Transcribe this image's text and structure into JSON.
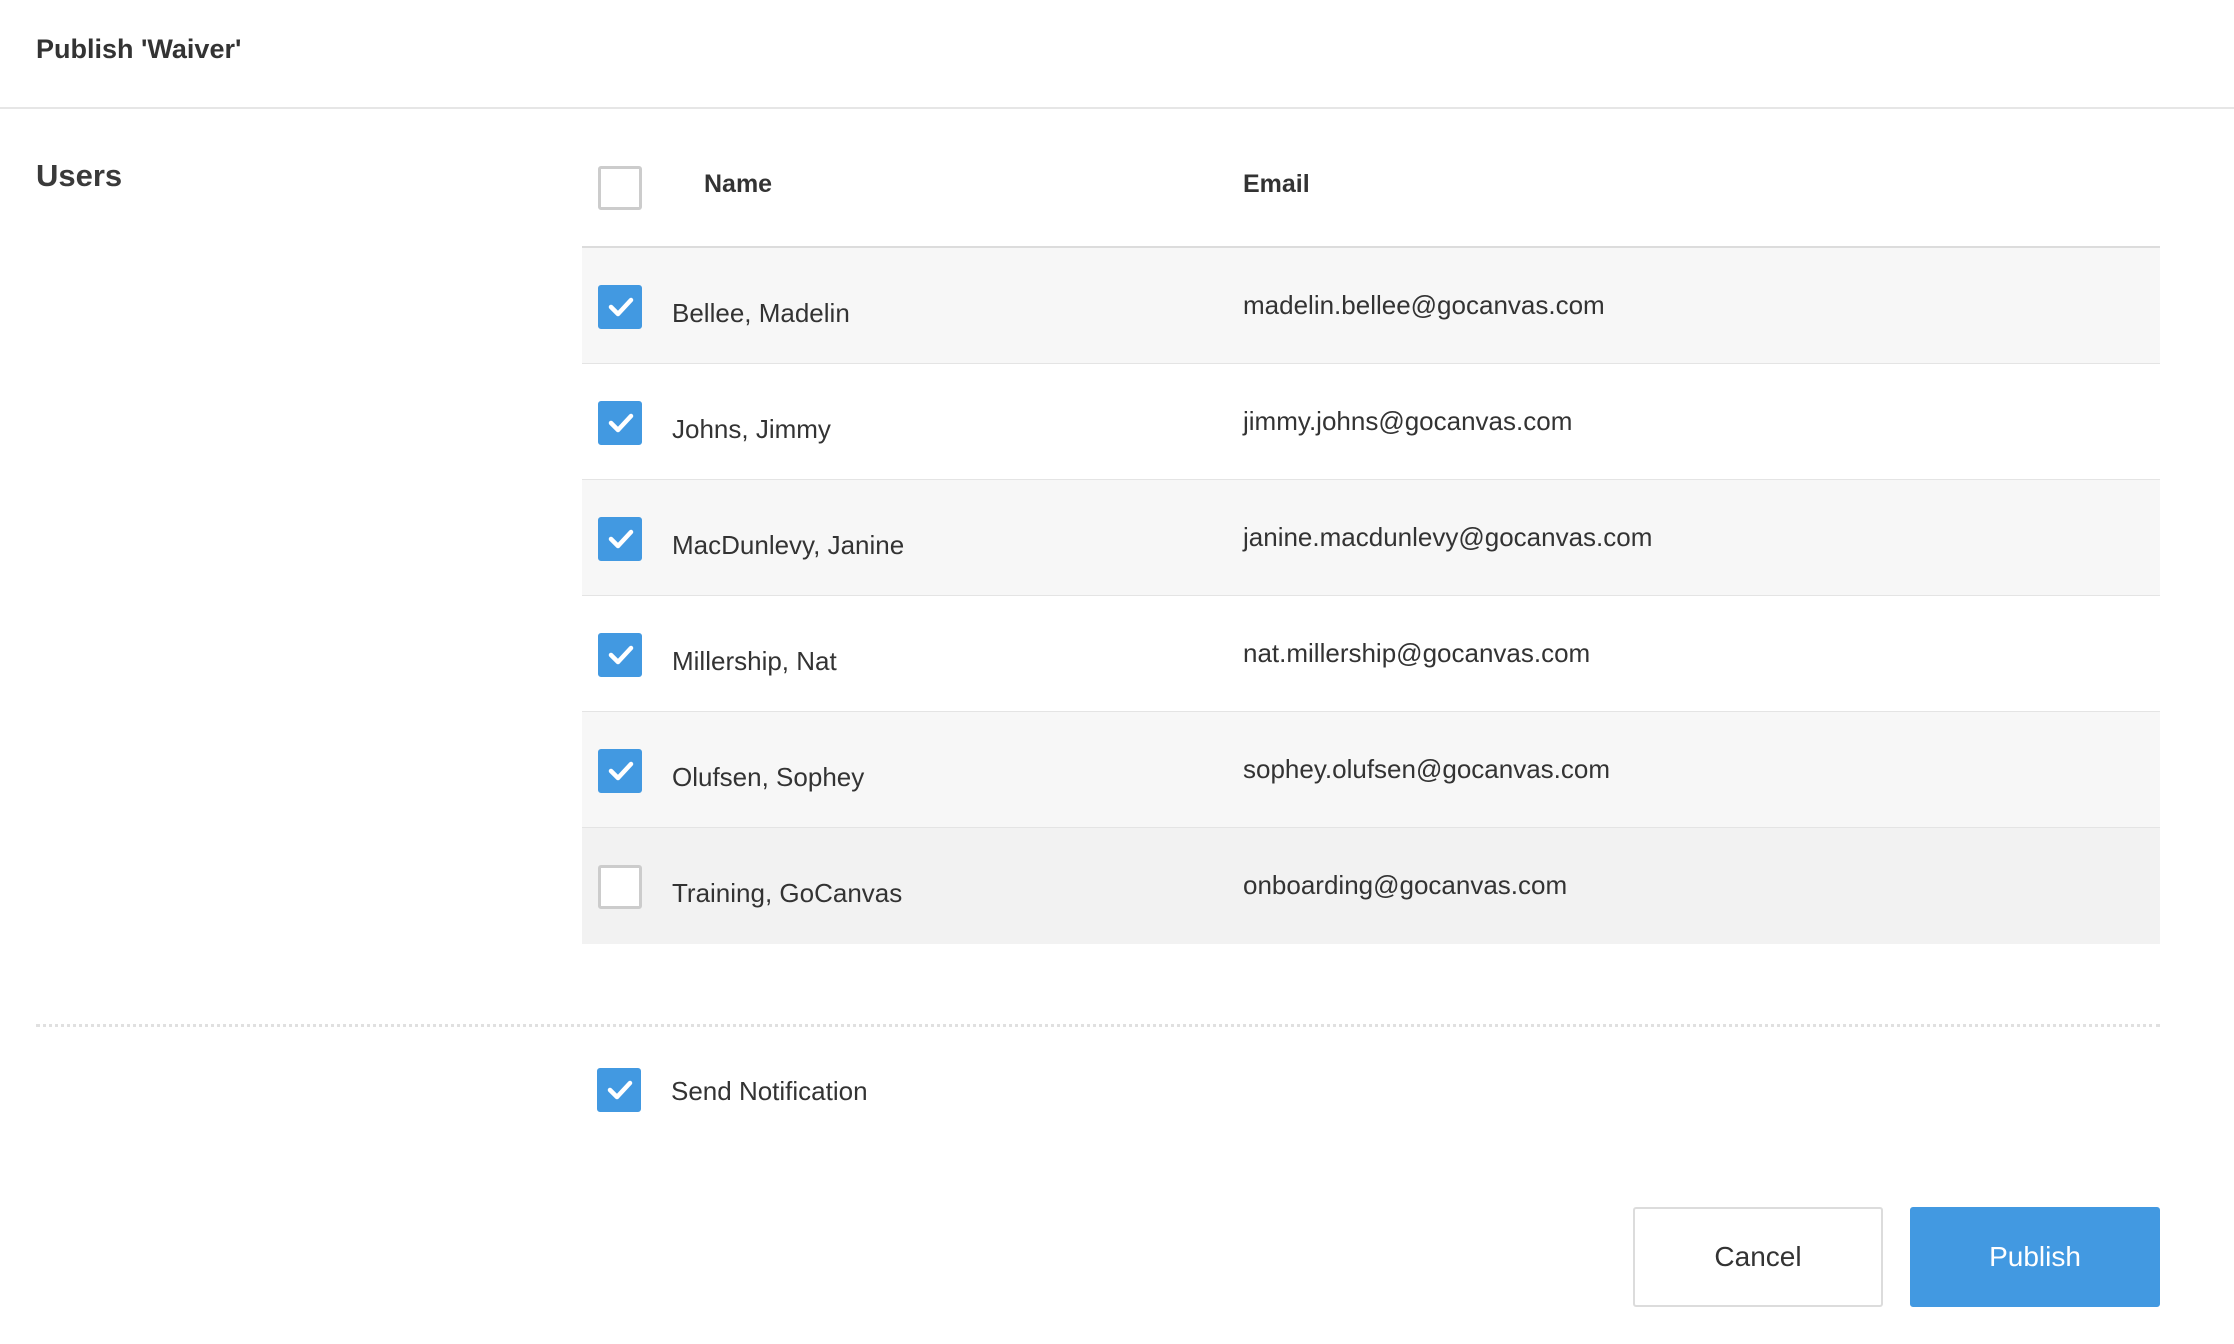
{
  "dialog": {
    "title": "Publish 'Waiver'"
  },
  "users_section": {
    "label": "Users",
    "select_all_checked": false,
    "columns": {
      "name": "Name",
      "email": "Email"
    },
    "rows": [
      {
        "name": "Bellee, Madelin",
        "email": "madelin.bellee@gocanvas.com",
        "checked": true
      },
      {
        "name": "Johns, Jimmy",
        "email": "jimmy.johns@gocanvas.com",
        "checked": true
      },
      {
        "name": "MacDunlevy, Janine",
        "email": "janine.macdunlevy@gocanvas.com",
        "checked": true
      },
      {
        "name": "Millership, Nat",
        "email": "nat.millership@gocanvas.com",
        "checked": true
      },
      {
        "name": "Olufsen, Sophey",
        "email": "sophey.olufsen@gocanvas.com",
        "checked": true
      },
      {
        "name": "Training, GoCanvas",
        "email": "onboarding@gocanvas.com",
        "checked": false
      }
    ]
  },
  "notification": {
    "label": "Send Notification",
    "checked": true
  },
  "footer": {
    "cancel_label": "Cancel",
    "publish_label": "Publish"
  },
  "colors": {
    "accent": "#4299e1",
    "row_alt": "#f7f7f7",
    "border": "#dcdcdc"
  },
  "icons": {
    "check": "checkmark-icon"
  }
}
